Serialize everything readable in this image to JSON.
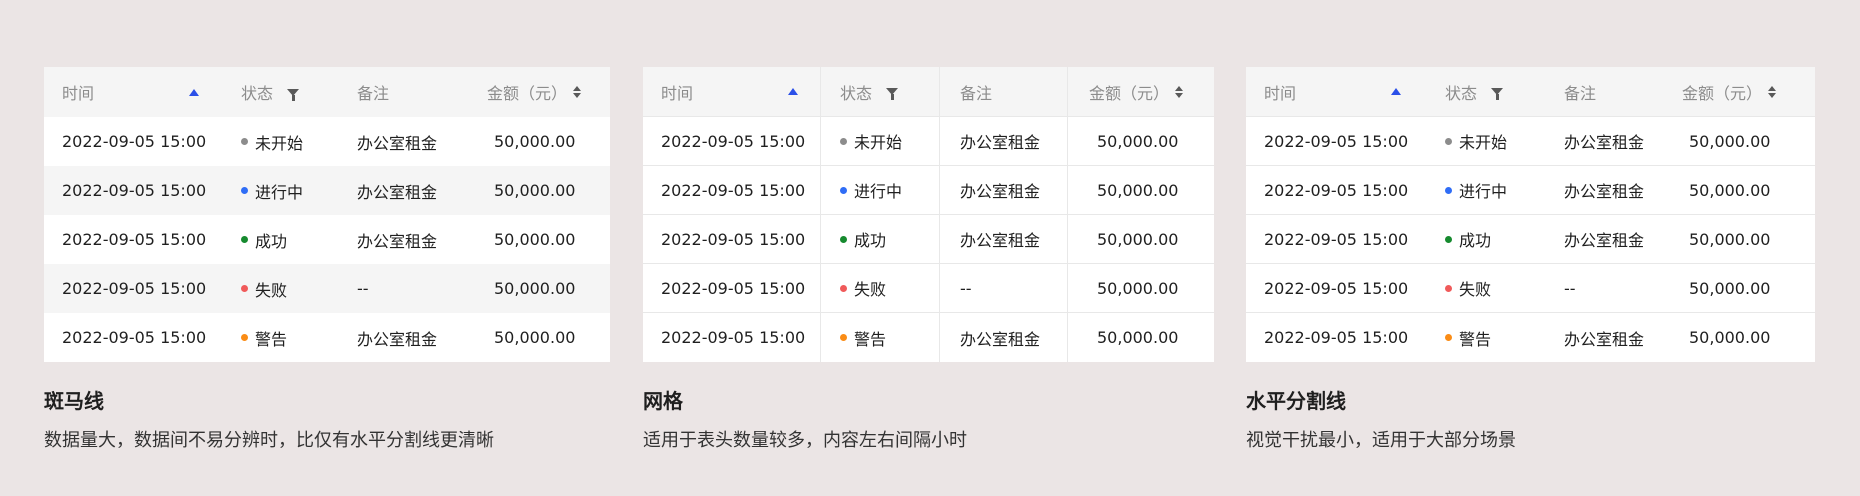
{
  "headers": {
    "time": "时间",
    "status": "状态",
    "note": "备注",
    "amount": "金额（元）"
  },
  "rows": [
    {
      "time": "2022-09-05 15:00",
      "status": "未开始",
      "status_color": "#8c8c8c",
      "note": "办公室租金",
      "amount": "50,000.00"
    },
    {
      "time": "2022-09-05 15:00",
      "status": "进行中",
      "status_color": "#2f6df6",
      "note": "办公室租金",
      "amount": "50,000.00"
    },
    {
      "time": "2022-09-05 15:00",
      "status": "成功",
      "status_color": "#168a2e",
      "note": "办公室租金",
      "amount": "50,000.00"
    },
    {
      "time": "2022-09-05 15:00",
      "status": "失败",
      "status_color": "#f05a5a",
      "note": "--",
      "amount": "50,000.00"
    },
    {
      "time": "2022-09-05 15:00",
      "status": "警告",
      "status_color": "#fa8c16",
      "note": "办公室租金",
      "amount": "50,000.00"
    }
  ],
  "sections": [
    {
      "title": "斑马线",
      "desc": "数据量大，数据间不易分辨时，比仅有水平分割线更清晰"
    },
    {
      "title": "网格",
      "desc": "适用于表头数量较多，内容左右间隔小时"
    },
    {
      "title": "水平分割线",
      "desc": "视觉干扰最小，适用于大部分场景"
    }
  ],
  "colors": {
    "background": "#ebe5e5",
    "sort_active": "#2b50e8"
  }
}
